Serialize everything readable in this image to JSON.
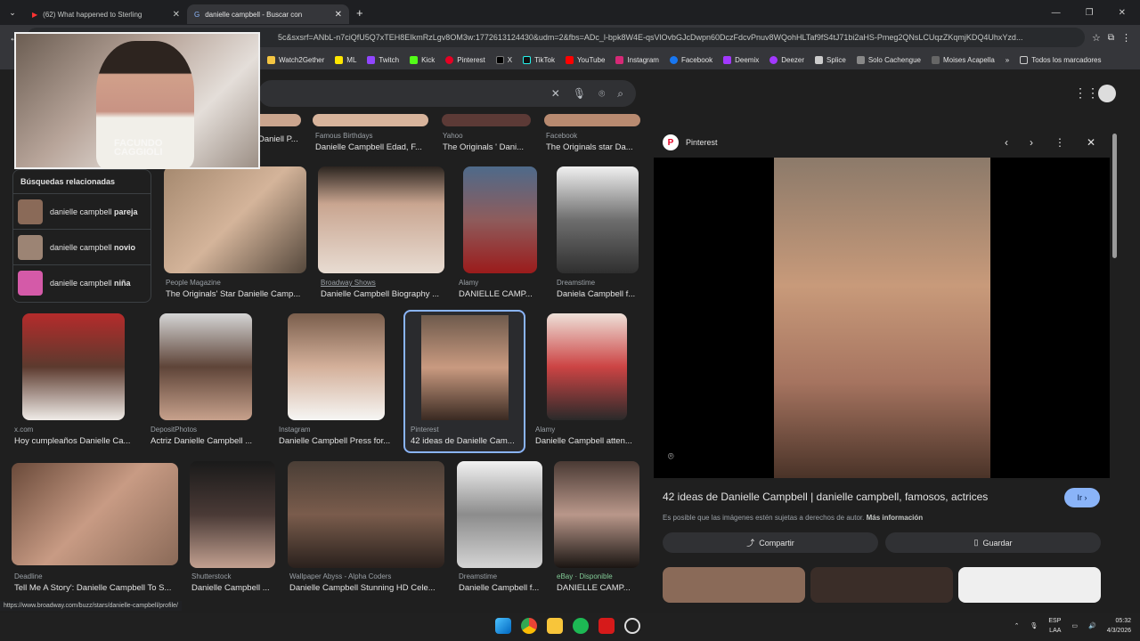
{
  "tabs": [
    {
      "title": "(62) What happened to Sterling",
      "active": false
    },
    {
      "title": "danielle campbell - Buscar con",
      "active": true
    }
  ],
  "url": "5c&sxsrf=ANbL-n7ciQfU5Q7xTEH8EIkmRzLgv8OM3w:1772613124430&udm=2&fbs=ADc_l-bpk8W4E-qsVlOvbGJcDwpn60DczFdcvPnuv8WQohHLTaf9fS4tJ71bi2aHS-Pmeg2QNsLCUqzZKqmjKDQ4UhxYzd...",
  "bookmarks": [
    "Watch2Gether",
    "ML",
    "Twitch",
    "Kick",
    "Pinterest",
    "X",
    "TikTok",
    "YouTube",
    "Instagram",
    "Facebook",
    "Deemix",
    "Deezer",
    "Splice",
    "Solo Cachengue",
    "Moises Acapella",
    "»",
    "Todos los marcadores"
  ],
  "webcam_watermark": "FACUNDO\nCAGGIOLI",
  "related": {
    "title": "Búsquedas relacionadas",
    "items": [
      {
        "prefix": "danielle campbell ",
        "bold": "pareja"
      },
      {
        "prefix": "danielle campbell ",
        "bold": "novio"
      },
      {
        "prefix": "danielle campbell ",
        "bold": "niña"
      }
    ]
  },
  "row0": [
    {
      "source": "",
      "title": "Daniell P..."
    },
    {
      "source": "Famous Birthdays",
      "title": "Danielle Campbell Edad, F..."
    },
    {
      "source": "Yahoo",
      "title": "The Originals ' Dani..."
    },
    {
      "source": "Facebook",
      "title": "The Originals star Da..."
    }
  ],
  "row1": [
    {
      "source": "People Magazine",
      "title": "The Originals' Star Danielle Camp..."
    },
    {
      "source": "Broadway Shows",
      "title": "Danielle Campbell Biography ..."
    },
    {
      "source": "Alamy",
      "title": "DANIELLE CAMP..."
    },
    {
      "source": "Dreamstime",
      "title": "Daniela Campbell f..."
    }
  ],
  "row2": [
    {
      "source": "x.com",
      "title": "Hoy cumpleaños Danielle Ca..."
    },
    {
      "source": "DepositPhotos",
      "title": "Actriz Danielle Campbell ..."
    },
    {
      "source": "Instagram",
      "title": "Danielle Campbell Press for..."
    },
    {
      "source": "Pinterest",
      "title": "42 ideas de Danielle Cam..."
    },
    {
      "source": "Alamy",
      "title": "Danielle Campbell atten..."
    }
  ],
  "row3": [
    {
      "source": "Deadline",
      "title": "Tell Me A Story': Danielle Campbell To S..."
    },
    {
      "source": "Shutterstock",
      "title": "Danielle Campbell ..."
    },
    {
      "source": "Wallpaper Abyss - Alpha Coders",
      "title": "Danielle Campbell Stunning HD Cele..."
    },
    {
      "source": "Dreamstime",
      "title": "Danielle Campbell f..."
    },
    {
      "source": "eBay · Disponible",
      "title": "DANIELLE CAMP..."
    }
  ],
  "preview": {
    "source": "Pinterest",
    "title": "42 ideas de Danielle Campbell | danielle campbell, famosos, actrices",
    "visit": "Ir",
    "copyright": "Es posible que las imágenes estén sujetas a derechos de autor.",
    "more_info": "Más información",
    "share": "Compartir",
    "save": "Guardar"
  },
  "status_url": "https://www.broadway.com/buzz/stars/danielle-campbell/profile/",
  "tray": {
    "lang1": "ESP",
    "lang2": "LAA",
    "time": "05:32",
    "date": "4/3/2026"
  }
}
